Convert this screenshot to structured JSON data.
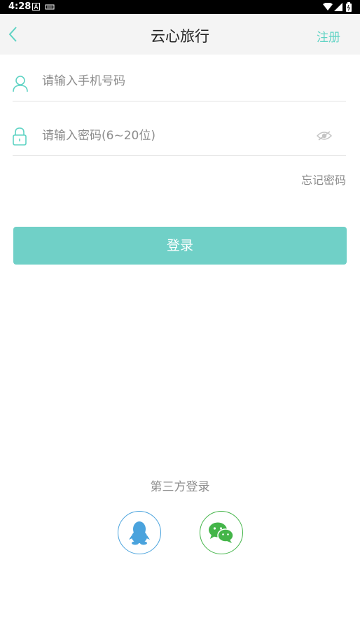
{
  "status_bar": {
    "time": "4:28"
  },
  "header": {
    "title": "云心旅行",
    "register_label": "注册"
  },
  "form": {
    "phone_placeholder": "请输入手机号码",
    "password_placeholder": "请输入密码(6~20位)",
    "forgot_label": "忘记密码",
    "login_label": "登录"
  },
  "third_party": {
    "title": "第三方登录"
  },
  "colors": {
    "accent": "#70d0c7",
    "qq": "#4aa3dd",
    "wechat": "#44b549"
  }
}
